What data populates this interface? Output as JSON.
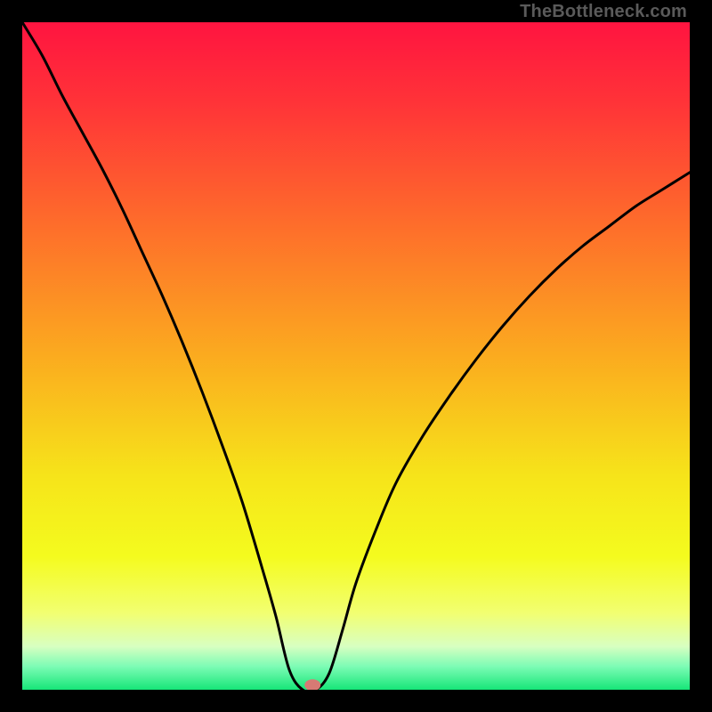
{
  "watermark": "TheBottleneck.com",
  "chart_data": {
    "type": "line",
    "title": "",
    "xlabel": "",
    "ylabel": "",
    "xlim": [
      0,
      100
    ],
    "ylim": [
      0,
      100
    ],
    "series": [
      {
        "name": "curve",
        "x": [
          0,
          3,
          6,
          9,
          12,
          15,
          18,
          21,
          24,
          27,
          30,
          33,
          36,
          38,
          40,
          42,
          44,
          46,
          48,
          50,
          53,
          56,
          60,
          64,
          68,
          72,
          76,
          80,
          84,
          88,
          92,
          96,
          100
        ],
        "y": [
          100,
          95,
          89,
          83.5,
          78,
          72,
          65.5,
          59,
          52,
          44.5,
          36.5,
          28,
          18,
          11,
          3,
          0,
          0,
          2.5,
          9,
          16,
          24,
          31,
          38,
          44,
          49.5,
          54.5,
          59,
          63,
          66.5,
          69.5,
          72.5,
          75,
          77.5
        ]
      }
    ],
    "marker": {
      "x": 43.5,
      "y": 0.7
    },
    "gradient_stops": [
      {
        "offset": 0.0,
        "color": "#ff1440"
      },
      {
        "offset": 0.12,
        "color": "#ff3338"
      },
      {
        "offset": 0.3,
        "color": "#fe6c2b"
      },
      {
        "offset": 0.5,
        "color": "#fbab1f"
      },
      {
        "offset": 0.68,
        "color": "#f6e41a"
      },
      {
        "offset": 0.8,
        "color": "#f4fb1e"
      },
      {
        "offset": 0.885,
        "color": "#f2ff71"
      },
      {
        "offset": 0.935,
        "color": "#d8ffc1"
      },
      {
        "offset": 0.965,
        "color": "#7dfcb5"
      },
      {
        "offset": 1.0,
        "color": "#16e678"
      }
    ]
  }
}
